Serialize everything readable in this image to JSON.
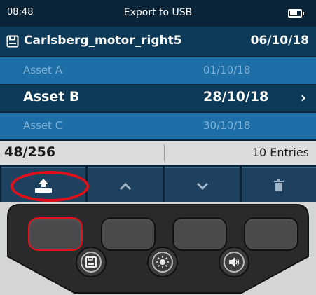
{
  "status": {
    "time": "08:48",
    "title": "Export to USB",
    "battery_icon": "battery-icon"
  },
  "file": {
    "icon": "floppy-disk-icon",
    "name": "Carlsberg_motor_right5",
    "date": "06/10/18"
  },
  "assets": [
    {
      "name": "Asset A",
      "date": "01/10/18",
      "selected": false
    },
    {
      "name": "Asset B",
      "date": "28/10/18",
      "selected": true,
      "chevron": "›"
    },
    {
      "name": "Asset C",
      "date": "30/10/18",
      "selected": false
    }
  ],
  "info": {
    "count": "48/256",
    "entries": "10 Entries"
  },
  "softkeys": [
    {
      "icon": "usb-export-icon"
    },
    {
      "icon": "chevron-up-icon"
    },
    {
      "icon": "chevron-down-icon"
    },
    {
      "icon": "trash-icon"
    }
  ],
  "hardware": {
    "buttons": [
      "function-button-1",
      "function-button-2",
      "function-button-3",
      "function-button-4"
    ],
    "round_buttons": [
      {
        "icon": "save-icon"
      },
      {
        "icon": "brightness-icon"
      },
      {
        "icon": "volume-icon"
      }
    ]
  },
  "colors": {
    "screen_bg": "#0b2438",
    "header_bg": "#0c3a58",
    "row_dim": "#1e6fa8",
    "highlight_red": "#e0101a"
  }
}
